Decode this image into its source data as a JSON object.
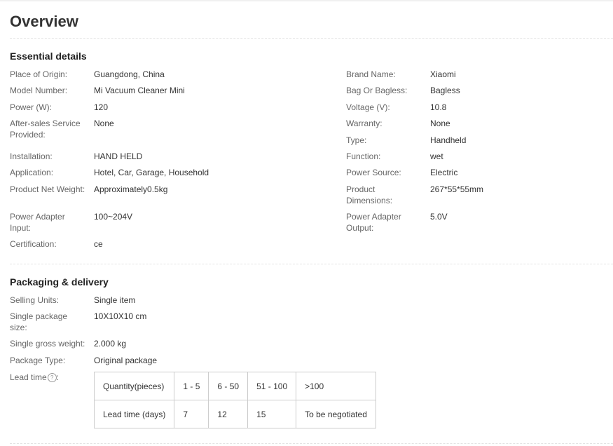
{
  "page": {
    "title": "Overview"
  },
  "essential": {
    "heading": "Essential details",
    "left": [
      {
        "label": "Place of Origin:",
        "value": "Guangdong, China"
      },
      {
        "label": "Model Number:",
        "value": "Mi Vacuum Cleaner Mini"
      },
      {
        "label": "Power (W):",
        "value": "120"
      },
      {
        "label": "After-sales Service Provided:",
        "value": "None"
      },
      {
        "label": "Installation:",
        "value": "HAND HELD"
      },
      {
        "label": "Application:",
        "value": "Hotel, Car, Garage, Household"
      },
      {
        "label": "Product Net Weight:",
        "value": "Approximately0.5kg"
      },
      {
        "label": "Power Adapter Input:",
        "value": "100~204V"
      },
      {
        "label": "Certification:",
        "value": "ce"
      }
    ],
    "right": [
      {
        "label": "Brand Name:",
        "value": "Xiaomi"
      },
      {
        "label": "Bag Or Bagless:",
        "value": "Bagless"
      },
      {
        "label": "Voltage (V):",
        "value": "10.8"
      },
      {
        "label": "Warranty:",
        "value": "None"
      },
      {
        "label": "Type:",
        "value": "Handheld"
      },
      {
        "label": "Function:",
        "value": "wet"
      },
      {
        "label": "Power Source:",
        "value": "Electric"
      },
      {
        "label": "Product Dimensions:",
        "value": "267*55*55mm"
      },
      {
        "label": "Power Adapter Output:",
        "value": "5.0V"
      }
    ]
  },
  "packaging": {
    "heading": "Packaging & delivery",
    "rows": [
      {
        "label": "Selling Units:",
        "value": "Single item"
      },
      {
        "label": "Single package size:",
        "value": "10X10X10 cm"
      },
      {
        "label": "Single gross weight:",
        "value": "2.000 kg"
      },
      {
        "label": "Package Type:",
        "value": "Original package"
      }
    ],
    "lead_time_label": "Lead time",
    "help_glyph": "?",
    "table": {
      "header": [
        "Quantity(pieces)",
        "1 - 5",
        "6 - 50",
        "51 - 100",
        ">100"
      ],
      "row": [
        "Lead time (days)",
        "7",
        "12",
        "15",
        "To be negotiated"
      ]
    }
  }
}
